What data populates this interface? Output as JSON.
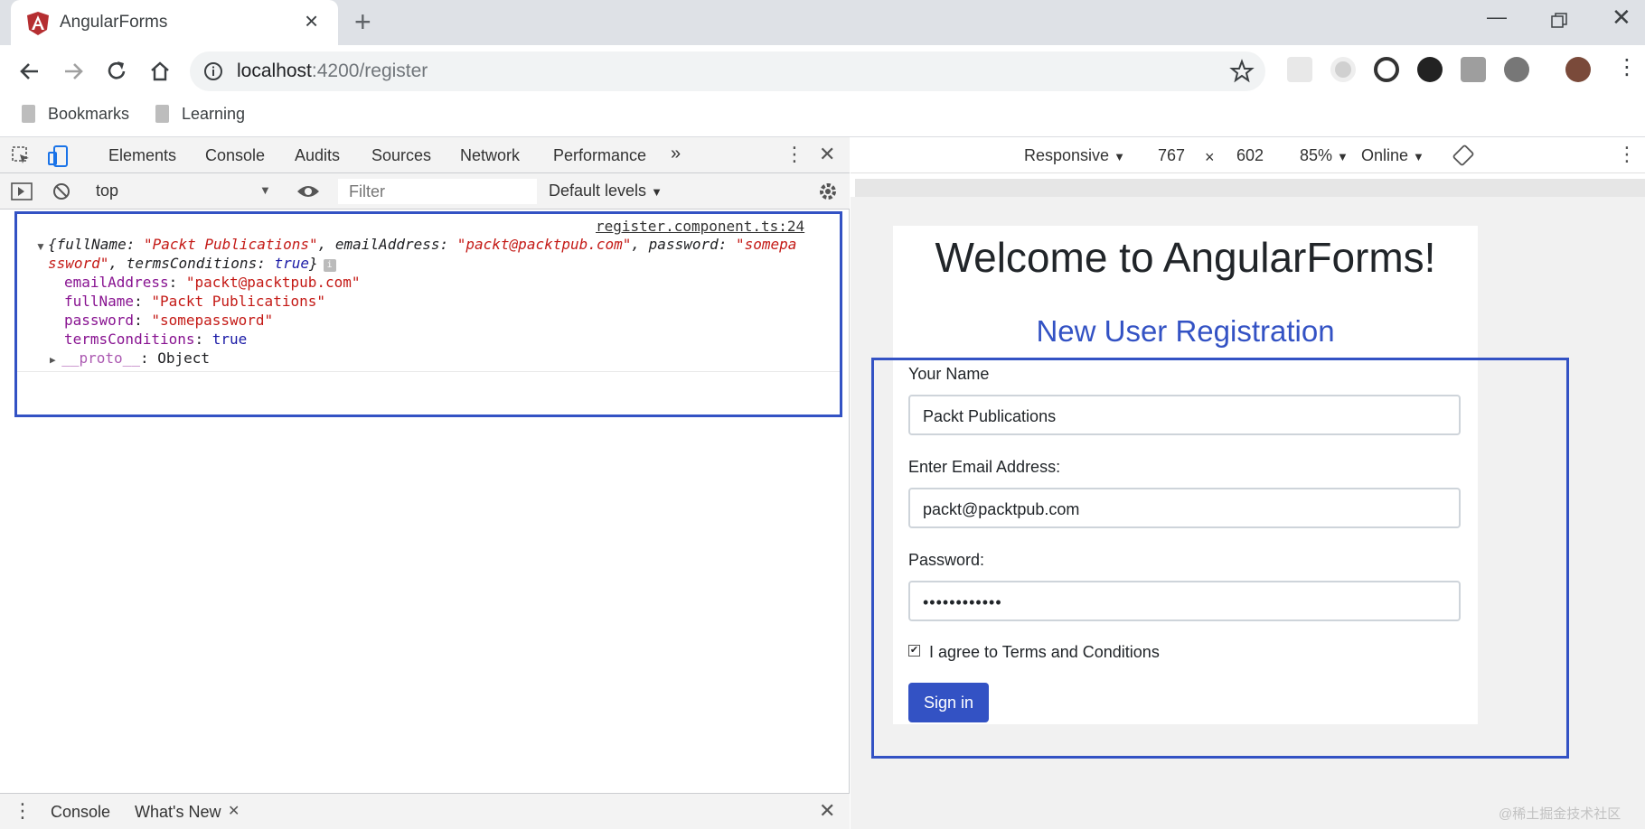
{
  "browser": {
    "tab_title": "AngularForms",
    "url_host": "localhost",
    "url_rest": ":4200/register",
    "bookmarks": [
      "Bookmarks",
      "Learning"
    ]
  },
  "devtools": {
    "tabs": [
      "Elements",
      "Console",
      "Audits",
      "Sources",
      "Network",
      "Performance"
    ],
    "active_tab": "Console",
    "more_tabs": "»",
    "context": "top",
    "filter_placeholder": "Filter",
    "levels": "Default levels",
    "log": {
      "source": "register.component.ts:24",
      "summary_prefix": "{fullName: ",
      "summary_fullname": "\"Packt Publications\"",
      "summary_email_key": ", emailAddress: ",
      "summary_email": "\"packt@packtpub.com\"",
      "summary_pw_key": ", password: ",
      "summary_pw": "\"somepa",
      "summary_line2_pw": "ssword\"",
      "summary_tc_key": ", termsConditions: ",
      "summary_tc": "true",
      "summary_close": "}",
      "props": [
        {
          "key": "emailAddress",
          "value": "\"packt@packtpub.com\""
        },
        {
          "key": "fullName",
          "value": "\"Packt Publications\""
        },
        {
          "key": "password",
          "value": "\"somepassword\""
        },
        {
          "key": "termsConditions",
          "value": "true"
        },
        {
          "key": "__proto__",
          "value": "Object"
        }
      ]
    },
    "drawer_tabs": [
      "Console",
      "What's New"
    ]
  },
  "device_toolbar": {
    "mode": "Responsive",
    "width": "767",
    "times": "×",
    "height": "602",
    "zoom": "85%",
    "network": "Online"
  },
  "app": {
    "heading": "Welcome to AngularForms!",
    "subheading": "New User Registration",
    "name_label": "Your Name",
    "name_value": "Packt Publications",
    "email_label": "Enter Email Address:",
    "email_value": "packt@packtpub.com",
    "password_label": "Password:",
    "password_value": "••••••••••••",
    "terms_label": "I agree to Terms and Conditions",
    "terms_checked": true,
    "submit_label": "Sign in"
  },
  "watermark": "@稀土掘金技术社区",
  "colors": {
    "accent": "#3352c4",
    "devtools_active": "#1a73e8"
  }
}
